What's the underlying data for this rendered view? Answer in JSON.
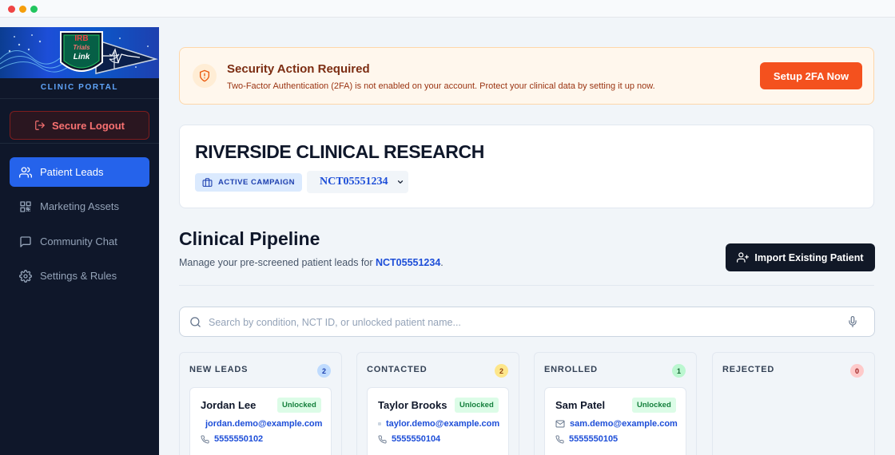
{
  "window": {
    "controls": [
      "close",
      "minimize",
      "maximize"
    ]
  },
  "sidebar": {
    "logo": {
      "line1": "IRB",
      "line2": "Trials",
      "line3": "Link"
    },
    "portal_label": "CLINIC PORTAL",
    "logout_label": "Secure Logout",
    "nav": [
      {
        "label": "Patient Leads",
        "icon": "users-icon",
        "active": true
      },
      {
        "label": "Marketing Assets",
        "icon": "qr-code-icon",
        "active": false
      },
      {
        "label": "Community Chat",
        "icon": "chat-icon",
        "active": false
      },
      {
        "label": "Settings & Rules",
        "icon": "gear-icon",
        "active": false
      }
    ]
  },
  "alert": {
    "title": "Security Action Required",
    "message": "Two-Factor Authentication (2FA) is not enabled on your account. Protect your clinical data by setting it up now.",
    "button": "Setup 2FA Now"
  },
  "clinic": {
    "name": "RIVERSIDE CLINICAL RESEARCH",
    "campaign_badge": "ACTIVE CAMPAIGN",
    "selected_trial": "NCT05551234"
  },
  "pipeline": {
    "title": "Clinical Pipeline",
    "subtitle_prefix": "Manage your pre-screened patient leads for ",
    "subtitle_trial": "NCT05551234",
    "subtitle_suffix": ".",
    "import_button": "Import Existing Patient"
  },
  "search": {
    "placeholder": "Search by condition, NCT ID, or unlocked patient name..."
  },
  "columns": [
    {
      "title": "NEW LEADS",
      "count": "2",
      "count_bg": "#bfdbfe",
      "count_fg": "#1e40af",
      "card": {
        "name": "Jordan Lee",
        "status": "Unlocked",
        "email": "jordan.demo@example.com",
        "phone": "5555550102"
      }
    },
    {
      "title": "CONTACTED",
      "count": "2",
      "count_bg": "#fde68a",
      "count_fg": "#92400e",
      "card": {
        "name": "Taylor Brooks",
        "status": "Unlocked",
        "email": "taylor.demo@example.com",
        "phone": "5555550104"
      }
    },
    {
      "title": "ENROLLED",
      "count": "1",
      "count_bg": "#bbf7d0",
      "count_fg": "#166534",
      "card": {
        "name": "Sam Patel",
        "status": "Unlocked",
        "email": "sam.demo@example.com",
        "phone": "5555550105"
      }
    },
    {
      "title": "REJECTED",
      "count": "0",
      "count_bg": "#fecaca",
      "count_fg": "#991b1b"
    }
  ],
  "colors": {
    "accent": "#2563eb",
    "sidebar_bg": "#0f172a",
    "alert_button": "#f4511e",
    "dark_button": "#111827"
  }
}
